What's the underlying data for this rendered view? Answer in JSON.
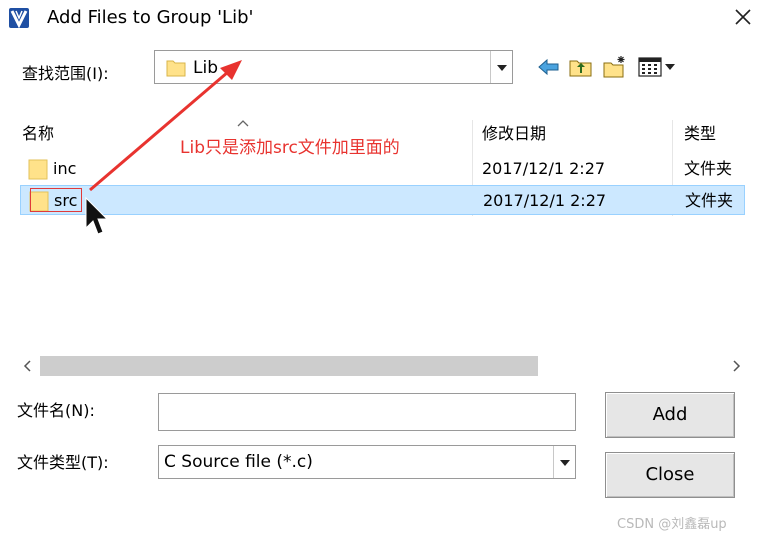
{
  "window": {
    "title": "Add Files to Group 'Lib'",
    "app_icon": "keil-uvision-icon",
    "close_icon": "close-icon"
  },
  "lookin": {
    "label": "查找范围(I):",
    "value": "Lib",
    "folder_icon": "folder-icon",
    "dropdown_icon": "chevron-down-icon"
  },
  "toolbar": {
    "icons": [
      "back-arrow-icon",
      "up-one-level-icon",
      "new-folder-icon",
      "view-menu-icon"
    ]
  },
  "list": {
    "columns": {
      "name": "名称",
      "date": "修改日期",
      "type": "类型"
    },
    "rows": [
      {
        "name": "inc",
        "date": "2017/12/1 2:27",
        "type": "文件夹",
        "selected": false
      },
      {
        "name": "src",
        "date": "2017/12/1 2:27",
        "type": "文件夹",
        "selected": true
      }
    ]
  },
  "annotation": {
    "text": "Lib只是添加src文件加里面的",
    "color": "#e8332f"
  },
  "fields": {
    "filename_label": "文件名(N):",
    "filename_value": "",
    "filetype_label": "文件类型(T):",
    "filetype_value": "C Source file (*.c)"
  },
  "buttons": {
    "add": "Add",
    "close": "Close"
  },
  "watermark": "CSDN @刘鑫磊up",
  "colors": {
    "selection_bg": "#cce8ff",
    "selection_border": "#99d1ff",
    "folder": "#ffe28a",
    "annotation": "#e8332f"
  }
}
